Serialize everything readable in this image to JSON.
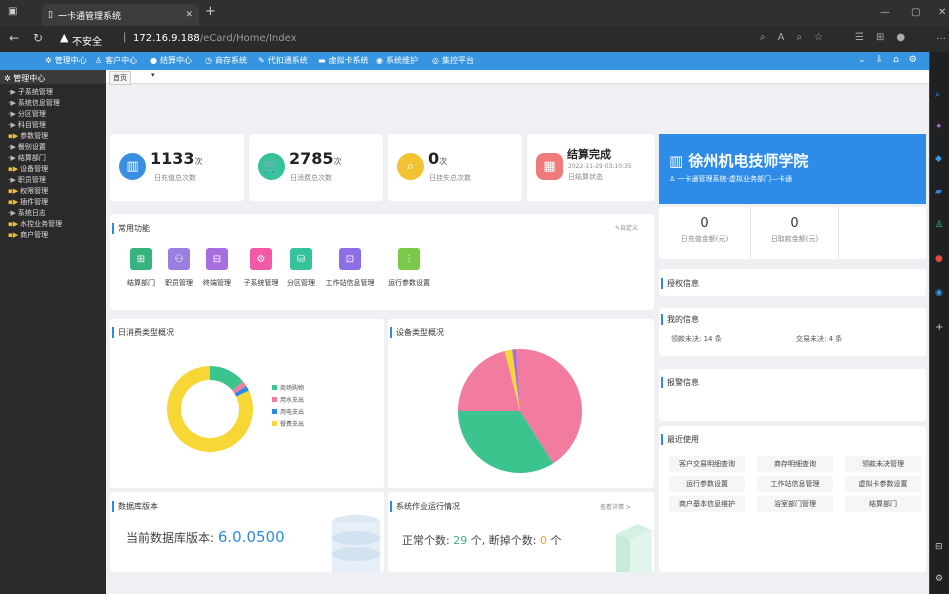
{
  "browser": {
    "tab_title": "一卡通管理系统",
    "insecure_label": "不安全",
    "url_host": "172.16.9.188",
    "url_path": "/eCard/Home/Index",
    "new_tab": "+"
  },
  "topnav": {
    "items": [
      "管理中心",
      "客户中心",
      "结算中心",
      "商存系统",
      "代扣通系统",
      "虚拟卡系统",
      "系统维护",
      "集控平台"
    ]
  },
  "sidebar": {
    "title": "管理中心",
    "items": [
      "子系统管理",
      "系统信息管理",
      "分区管理",
      "科目管理",
      "参数管理",
      "餐别设置",
      "结算部门",
      "设备管理",
      "职员管理",
      "权限管理",
      "插件管理",
      "系统日志",
      "水控业务管理",
      "商户管理"
    ]
  },
  "breadcrumb": {
    "home": "首页"
  },
  "stats": [
    {
      "value": "1133",
      "unit": "次",
      "label": "日充值总次数",
      "color": "#3b8fe0",
      "icon": "chart-icon"
    },
    {
      "value": "2785",
      "unit": "次",
      "label": "日消费总次数",
      "color": "#36c29a",
      "icon": "cart-icon"
    },
    {
      "value": "0",
      "unit": "次",
      "label": "日挂失总次数",
      "color": "#f2c232",
      "icon": "search-icon"
    },
    {
      "title": "结算完成",
      "time": "2022-11-29 03:10:35",
      "label": "日结算状态",
      "color": "#f07b7b",
      "icon": "calculator-icon"
    }
  ],
  "school": {
    "name": "徐州机电技师学院",
    "desc": "一卡通管理系统-虚拟业务部门—卡通",
    "recharge_value": "0",
    "recharge_label": "日充值金额(元)",
    "withdraw_value": "0",
    "withdraw_label": "日取款金额(元)"
  },
  "functions": {
    "title": "常用功能",
    "customize": "自定义",
    "items": [
      {
        "label": "结算部门",
        "color": "#36b37e"
      },
      {
        "label": "职员管理",
        "color": "#9b7fe0"
      },
      {
        "label": "终端管理",
        "color": "#a66ee0"
      },
      {
        "label": "子系统管理",
        "color": "#f25aa8"
      },
      {
        "label": "分区管理",
        "color": "#36c29a"
      },
      {
        "label": "工作站信息管理",
        "color": "#8c6fe6"
      },
      {
        "label": "运行参数设置",
        "color": "#7ac94a"
      }
    ]
  },
  "panels": {
    "auth_title": "授权信息",
    "my_title": "我的信息",
    "my_info_left": "领款未决: 14 条",
    "my_info_right": "交易未决: 4 条",
    "alarm_title": "报警信息",
    "recent_title": "最近使用",
    "recent_items": [
      "客户交易明细查询",
      "商存明细查询",
      "领款未决管理",
      "运行参数设置",
      "工作站信息管理",
      "虚拟卡参数设置",
      "商户基本信息维护",
      "浴室部门管理",
      "结算部门"
    ]
  },
  "donut": {
    "title": "日消费类型概况",
    "legend": [
      "商场购物",
      "用水支出",
      "用电支出",
      "餐费支出"
    ],
    "colors": [
      "#3cc48e",
      "#f17ca0",
      "#2d8ae0",
      "#f7d735"
    ]
  },
  "pie": {
    "title": "设备类型概况"
  },
  "db": {
    "title": "数据库版本",
    "label": "当前数据库版本:",
    "version": "6.0.0500"
  },
  "jobs": {
    "title": "系统作业运行情况",
    "link": "查看详情 >",
    "normal_label": "正常个数:",
    "normal_value": "29",
    "normal_unit": "个,",
    "broken_label": "断掉个数:",
    "broken_value": "0",
    "broken_unit": "个"
  },
  "chart_data": [
    {
      "type": "pie",
      "title": "日消费类型概况",
      "categories": [
        "商场购物",
        "用水支出",
        "用电支出",
        "餐费支出"
      ],
      "values": [
        14,
        2,
        2,
        82
      ]
    },
    {
      "type": "pie",
      "title": "设备类型概况",
      "values": [
        42,
        34,
        21,
        2,
        1
      ],
      "colors": [
        "#f17ca0",
        "#3cc48e",
        "#f17ca0",
        "#f7d735",
        "#a66ee0"
      ]
    }
  ]
}
